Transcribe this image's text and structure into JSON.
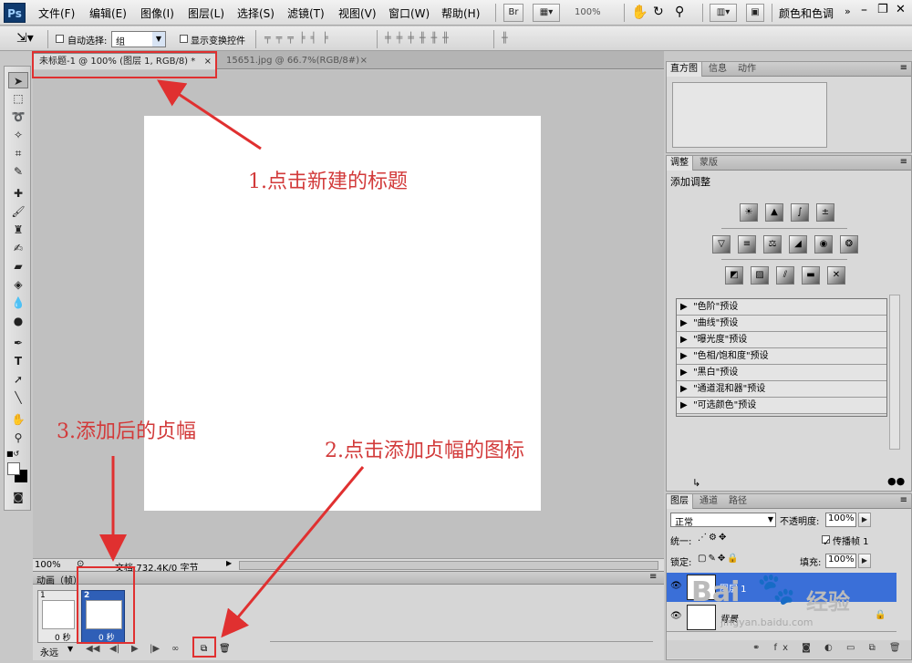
{
  "app": {
    "logo": "Ps"
  },
  "menu": [
    "文件(F)",
    "编辑(E)",
    "图像(I)",
    "图层(L)",
    "选择(S)",
    "滤镜(T)",
    "视图(V)",
    "窗口(W)",
    "帮助(H)"
  ],
  "toolbar": {
    "br": "Br",
    "zoom": "100%",
    "workspace": "颜色和色调"
  },
  "options": {
    "auto_select_label": "自动选择:",
    "auto_select_value": "组",
    "show_transform_label": "显示变换控件"
  },
  "tabs": [
    "未标题-1 @ 100% (图层 1, RGB/8) *",
    "15651.jpg @ 66.7%(RGB/8#)"
  ],
  "status": {
    "zoom": "100%",
    "doc": "文档:732.4K/0 字节"
  },
  "animation": {
    "title": "动画（帧）",
    "frames": [
      {
        "num": "1",
        "time": "0 秒"
      },
      {
        "num": "2",
        "time": "0 秒"
      }
    ],
    "loop": "永远"
  },
  "panels": {
    "histogram_tabs": [
      "直方图",
      "信息",
      "动作"
    ],
    "adjust_tabs": [
      "调整",
      "蒙版"
    ],
    "adjust_title": "添加调整",
    "presets": [
      "\"色阶\"预设",
      "\"曲线\"预设",
      "\"曝光度\"预设",
      "\"色相/饱和度\"预设",
      "\"黑白\"预设",
      "\"通道混和器\"预设",
      "\"可选颜色\"预设"
    ],
    "layers_tabs": [
      "图层",
      "通道",
      "路径"
    ],
    "blend_mode": "正常",
    "opacity_label": "不透明度:",
    "opacity_value": "100%",
    "unify_label": "统一:",
    "propagate_label": "传播帧 1",
    "lock_label": "锁定:",
    "fill_label": "填充:",
    "fill_value": "100%",
    "layers": [
      "图层 1",
      "背景"
    ]
  },
  "annotations": {
    "a1": "1.点击新建的标题",
    "a2": "2.点击添加贞幅的图标",
    "a3": "3.添加后的贞幅"
  },
  "watermark": {
    "brand": "Bai",
    "brand2": "经验",
    "url": "jingyan.baidu.com"
  }
}
